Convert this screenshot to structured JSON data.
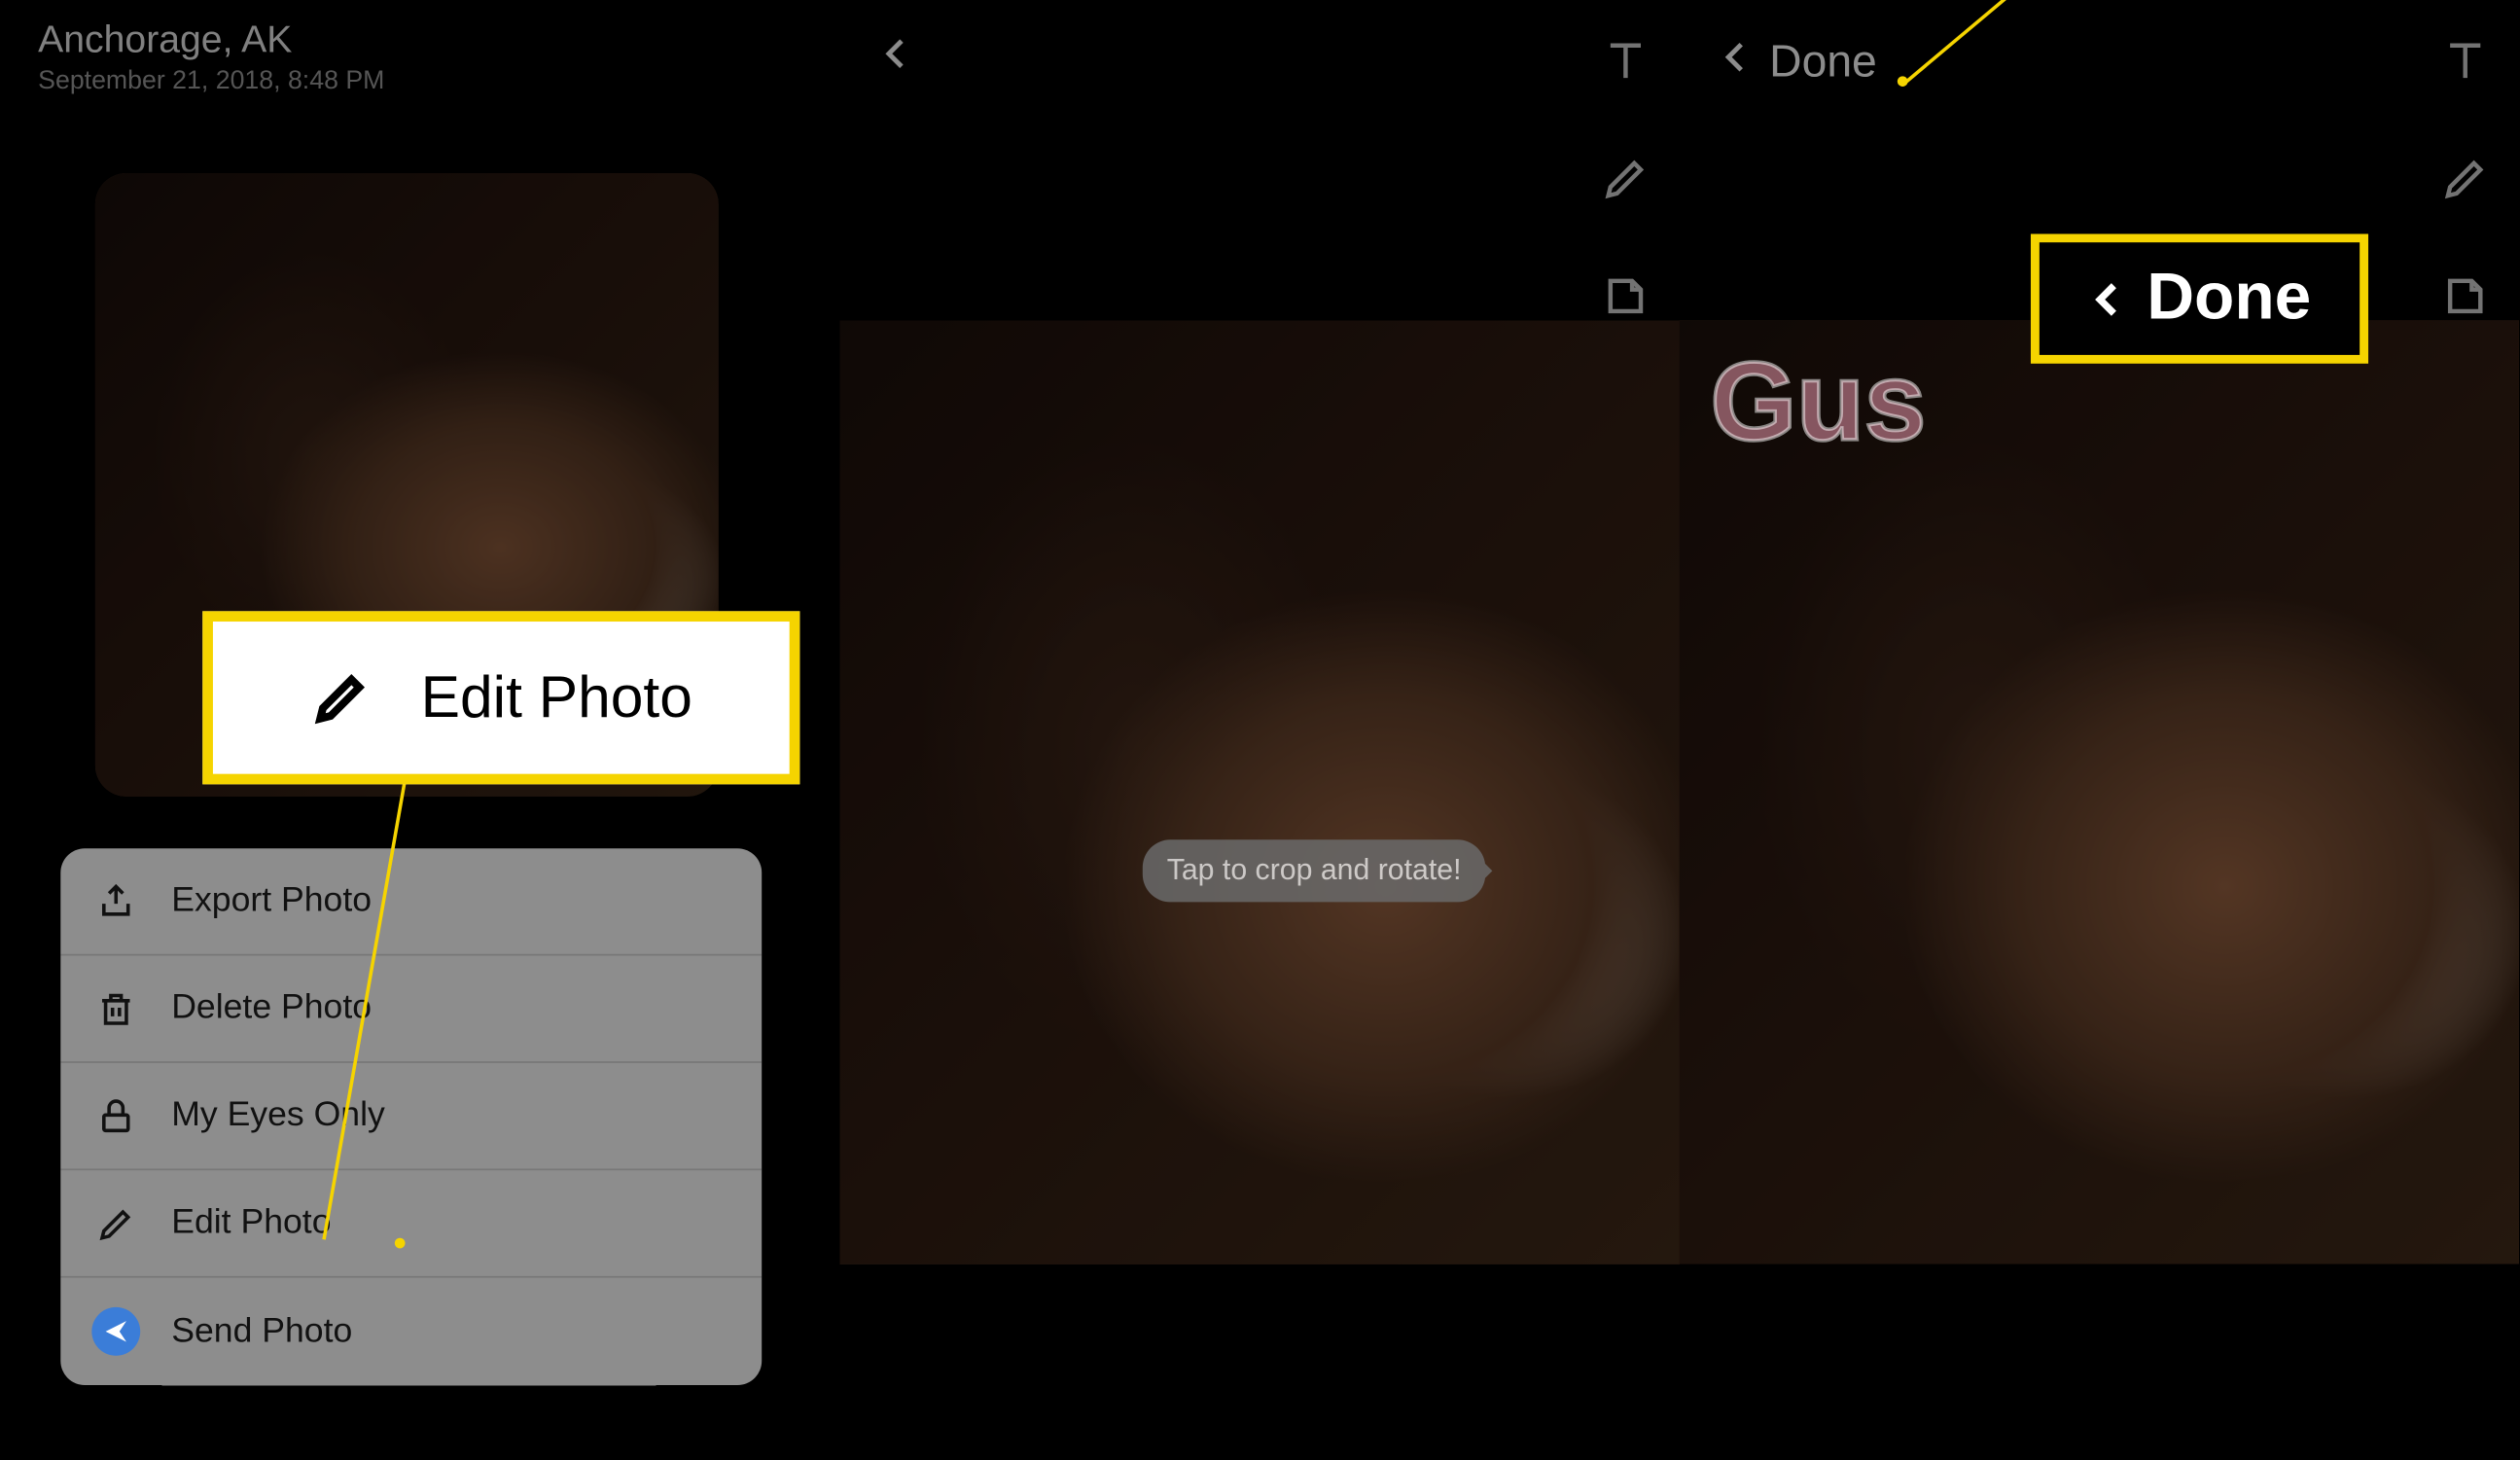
{
  "panel1": {
    "location": "Anchorage, AK",
    "date": "September 21, 2018, 8:48 PM",
    "menu": {
      "export": "Export Photo",
      "delete": "Delete Photo",
      "myeyes": "My Eyes Only",
      "edit": "Edit Photo",
      "send": "Send Photo"
    }
  },
  "callouts": {
    "editphoto": "Edit Photo",
    "done": "Done"
  },
  "panel2": {
    "tooltip": "Tap to crop and rotate!"
  },
  "panel3": {
    "done_label": "Done",
    "overlay_text": "Gus"
  }
}
